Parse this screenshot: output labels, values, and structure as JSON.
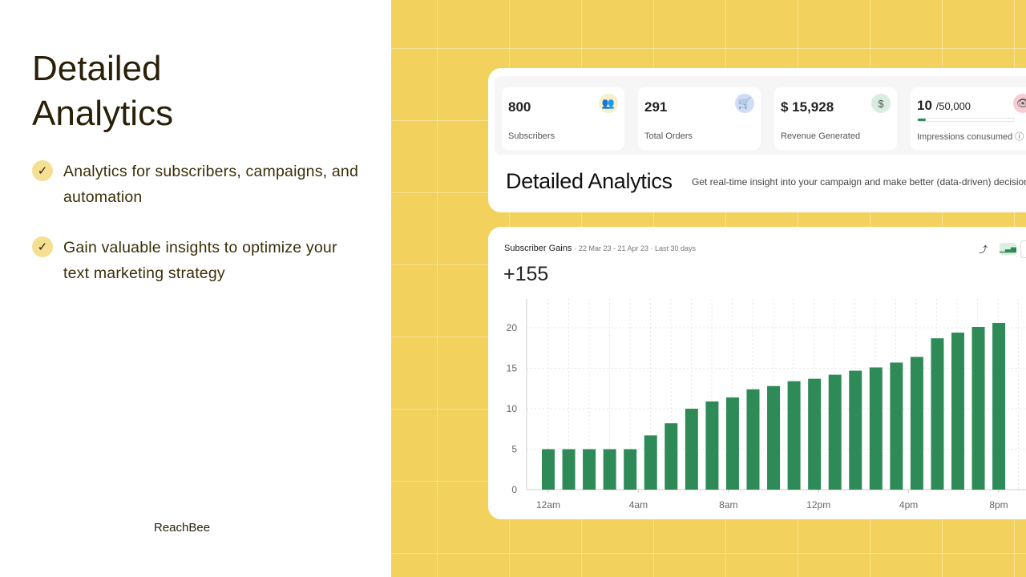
{
  "left": {
    "title_line1": "Detailed",
    "title_line2": "Analytics",
    "bullets": [
      "Analytics for subscribers, campaigns, and automation",
      "Gain valuable insights to optimize your text marketing strategy"
    ],
    "brand": "ReachBee"
  },
  "stats": [
    {
      "value": "800",
      "label": "Subscribers",
      "icon": "users-icon",
      "icon_bg": "#f7efc9"
    },
    {
      "value": "291",
      "label": "Total Orders",
      "icon": "cart-icon",
      "icon_bg": "#cfdcf7"
    },
    {
      "value": "$ 15,928",
      "label": "Revenue Generated",
      "icon": "dollar-icon",
      "icon_bg": "#d9ece0"
    },
    {
      "value": "10",
      "value_suffix": "/50,000",
      "label": "Impressions conusumed",
      "icon": "eye-icon",
      "icon_bg": "#f6cdd5",
      "progress": 0.0002
    }
  ],
  "header": {
    "title": "Detailed Analytics",
    "subtitle": "Get real-time insight into your campaign and make better (data-driven) decisions."
  },
  "chart_card": {
    "title": "Subscriber Gains",
    "meta": "· 22 Mar 23 - 21 Apr 23 · Last 30 days",
    "total": "+155"
  },
  "colors": {
    "accent": "#2e8b57",
    "background": "#f2d15c"
  },
  "chart_data": {
    "type": "bar",
    "x_tick_labels": [
      "12am",
      "4am",
      "8am",
      "12pm",
      "4pm",
      "8pm"
    ],
    "values": [
      5,
      5,
      5,
      5,
      5,
      6.7,
      8.2,
      10,
      10.9,
      11.4,
      12.4,
      12.8,
      13.4,
      13.7,
      14.2,
      14.7,
      15.1,
      15.7,
      16.4,
      18.7,
      19.4,
      20.1,
      20.6
    ],
    "y_ticks": [
      0,
      5,
      10,
      15,
      20
    ],
    "ylim": [
      0,
      23
    ],
    "grid": true,
    "color": "#2e8b57"
  }
}
